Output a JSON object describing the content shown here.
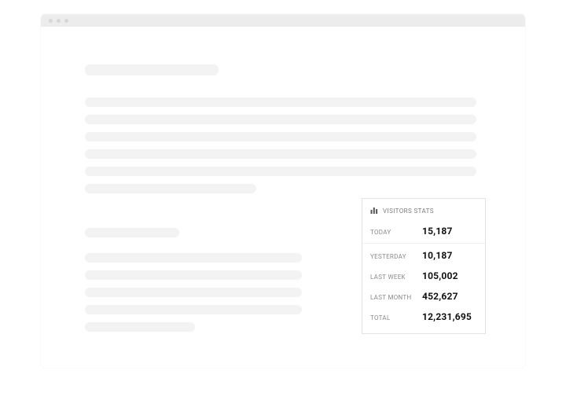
{
  "stats": {
    "title": "VISITORS STATS",
    "rows": [
      {
        "label": "TODAY",
        "value": "15,187"
      },
      {
        "label": "YESTERDAY",
        "value": "10,187"
      },
      {
        "label": "LAST WEEK",
        "value": "105,002"
      },
      {
        "label": "LAST MONTH",
        "value": "452,627"
      },
      {
        "label": "TOTAL",
        "value": "12,231,695"
      }
    ]
  }
}
